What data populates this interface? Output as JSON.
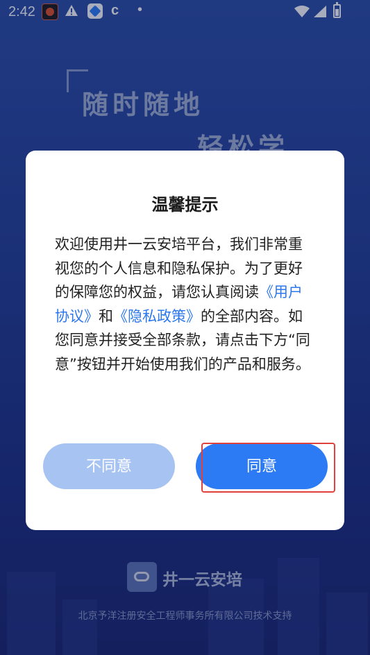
{
  "status_bar": {
    "time": "2:42",
    "icons": [
      "app-notification-icon",
      "warning-icon",
      "app-icon",
      "c-icon",
      "dot-icon",
      "wifi-icon",
      "signal-icon",
      "battery-icon"
    ]
  },
  "background": {
    "slogan_line1": "随时随地",
    "slogan_line2": "轻松学"
  },
  "dialog": {
    "title": "温馨提示",
    "body_part1": "欢迎使用井一云安培平台，我们非常重视您的个人信息和隐私保护。为了更好的保障您的权益，请您认真阅读",
    "user_agreement_link": "《用户协议》",
    "body_and": "和",
    "privacy_policy_link": "《隐私政策》",
    "body_part2": "的全部内容。如您同意并接受全部条款，请点击下方“同意”按钮并开始使用我们的产品和服务。",
    "disagree_label": "不同意",
    "agree_label": "同意"
  },
  "brand": {
    "name": "井一云安培"
  },
  "footer": {
    "support_text": "北京予洋注册安全工程师事务所有限公司技术支持"
  },
  "colors": {
    "accent": "#2c7bf4",
    "disabled_button": "#a6c3f1",
    "link": "#2b77ee",
    "highlight": "#e0413a"
  }
}
